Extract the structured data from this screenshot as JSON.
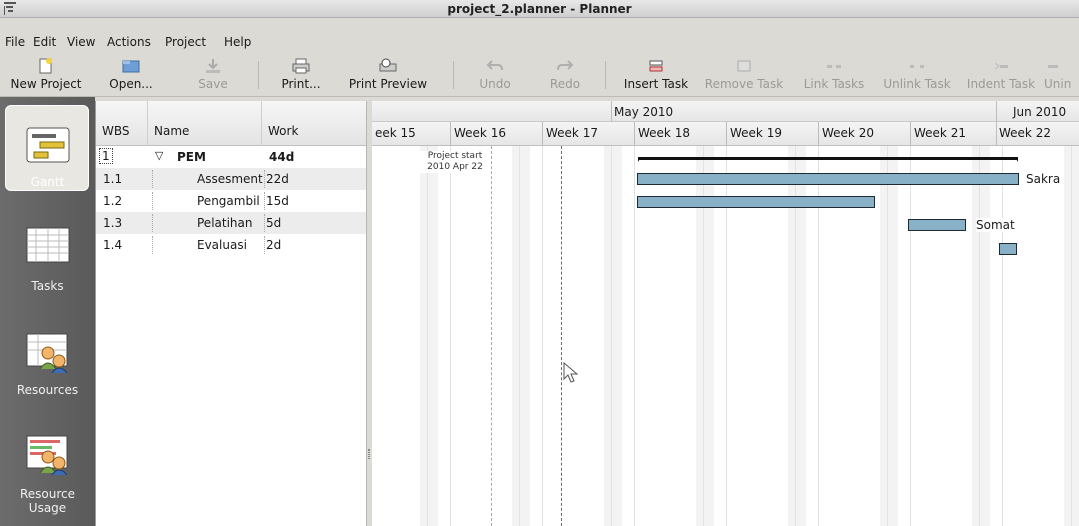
{
  "window": {
    "title": "project_2.planner - Planner"
  },
  "menu": [
    "File",
    "Edit",
    "View",
    "Actions",
    "Project",
    "Help"
  ],
  "toolbar": {
    "new_project": "New Project",
    "open": "Open...",
    "save": "Save",
    "print": "Print...",
    "print_preview": "Print Preview",
    "undo": "Undo",
    "redo": "Redo",
    "insert_task": "Insert Task",
    "remove_task": "Remove Task",
    "link_tasks": "Link Tasks",
    "unlink_task": "Unlink Task",
    "indent_task": "Indent Task",
    "unindent": "Unin"
  },
  "views": {
    "gantt": "Gantt",
    "tasks": "Tasks",
    "resources": "Resources",
    "resource_usage": "Resource Usage"
  },
  "table": {
    "headers": {
      "wbs": "WBS",
      "name": "Name",
      "work": "Work"
    },
    "rows": [
      {
        "wbs": "1",
        "name": "PEM",
        "work": "44d"
      },
      {
        "wbs": "1.1",
        "name": "Assesment",
        "work": "22d"
      },
      {
        "wbs": "1.2",
        "name": "Pengambil",
        "work": "15d"
      },
      {
        "wbs": "1.3",
        "name": "Pelatihan",
        "work": "5d"
      },
      {
        "wbs": "1.4",
        "name": "Evaluasi",
        "work": "2d"
      }
    ]
  },
  "gantt": {
    "months": [
      "May 2010",
      "Jun 2010"
    ],
    "weeks": [
      "eek 15",
      "Week 16",
      "Week 17",
      "Week 18",
      "Week 19",
      "Week 20",
      "Week 21",
      "Week 22"
    ],
    "project_start_line1": "Project start",
    "project_start_line2": "2010 Apr 22",
    "labels": {
      "sakra": "Sakra",
      "somat": "Somat"
    }
  },
  "colors": {
    "bar": "#88b0c7",
    "sidebar": "#626262"
  }
}
